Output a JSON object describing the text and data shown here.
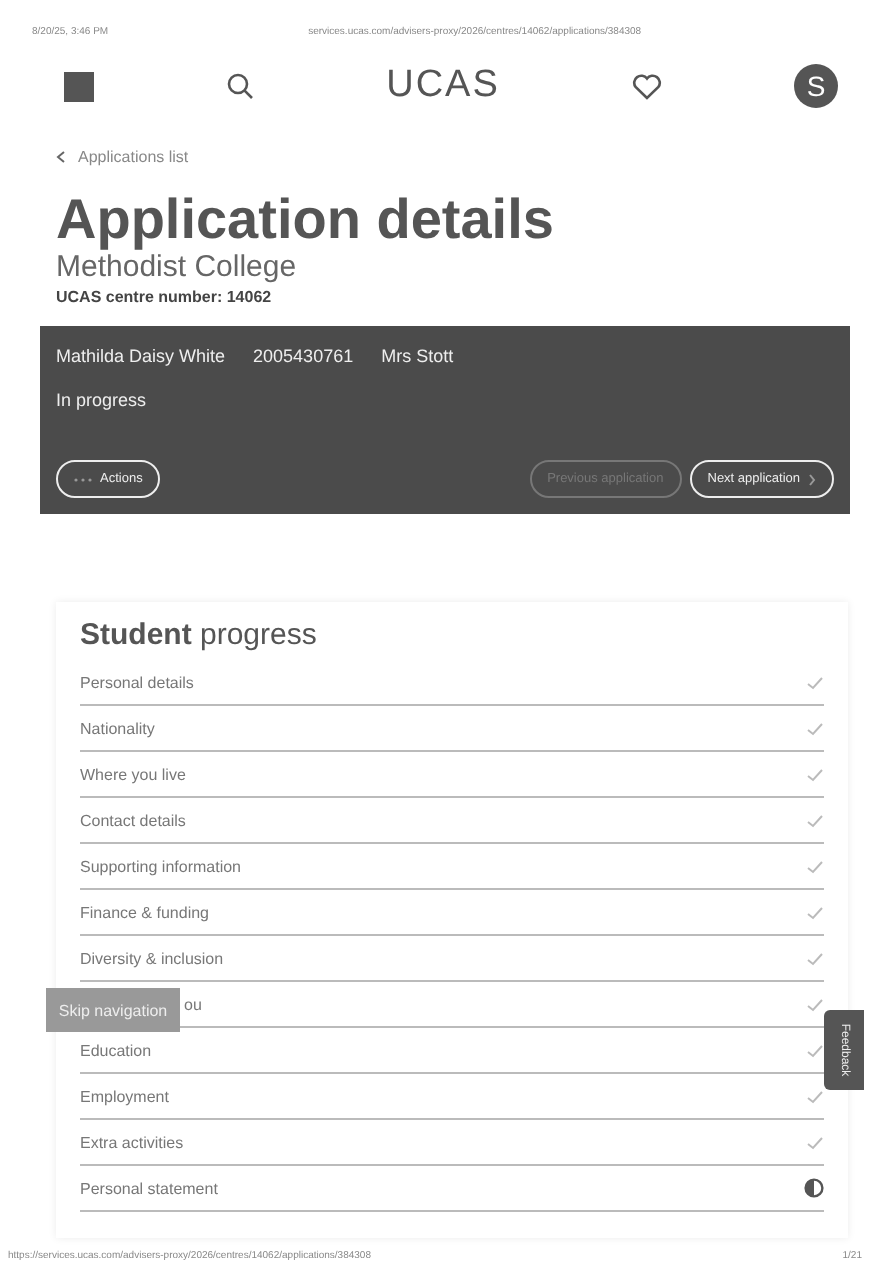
{
  "print_header": {
    "date": "8/20/25, 3:46 PM",
    "url": "services.ucas.com/advisers-proxy/2026/centres/14062/applications/384308"
  },
  "nav": {
    "logo": "UCAS",
    "avatar": "S"
  },
  "breadcrumb": "Applications list",
  "title": "Application details",
  "subtitle": "Methodist College",
  "centre_number": "UCAS centre number: 14062",
  "student": {
    "name": "Mathilda Daisy White",
    "id": "2005430761",
    "adviser": "Mrs Stott",
    "status": "In progress"
  },
  "buttons": {
    "actions": {
      "label": "Actions",
      "disabled": false
    },
    "previous": {
      "label": "Previous application",
      "disabled": true
    },
    "next": {
      "label": "Next application",
      "disabled": false
    }
  },
  "progress": {
    "title_bold": "Student",
    "title_rest": "progress",
    "rows": [
      {
        "label": "Personal details",
        "kind": "complete"
      },
      {
        "label": "Nationality",
        "kind": "complete"
      },
      {
        "label": "Where you live",
        "kind": "complete"
      },
      {
        "label": "Contact details",
        "kind": "complete"
      },
      {
        "label": "Supporting information",
        "kind": "complete"
      },
      {
        "label": "Finance & funding",
        "kind": "complete"
      },
      {
        "label": "Diversity & inclusion",
        "kind": "complete"
      },
      {
        "label": "ou",
        "kind": "complete",
        "covered": true
      },
      {
        "label": "Education",
        "kind": "complete"
      },
      {
        "label": "Employment",
        "kind": "complete"
      },
      {
        "label": "Extra activities",
        "kind": "complete"
      },
      {
        "label": "Personal statement",
        "kind": "partial"
      }
    ]
  },
  "skip_navigation": "Skip navigation",
  "feedback": "Feedback",
  "print_footer": {
    "url": "https://services.ucas.com/advisers-proxy/2026/centres/14062/applications/384308",
    "page": "1/21"
  }
}
